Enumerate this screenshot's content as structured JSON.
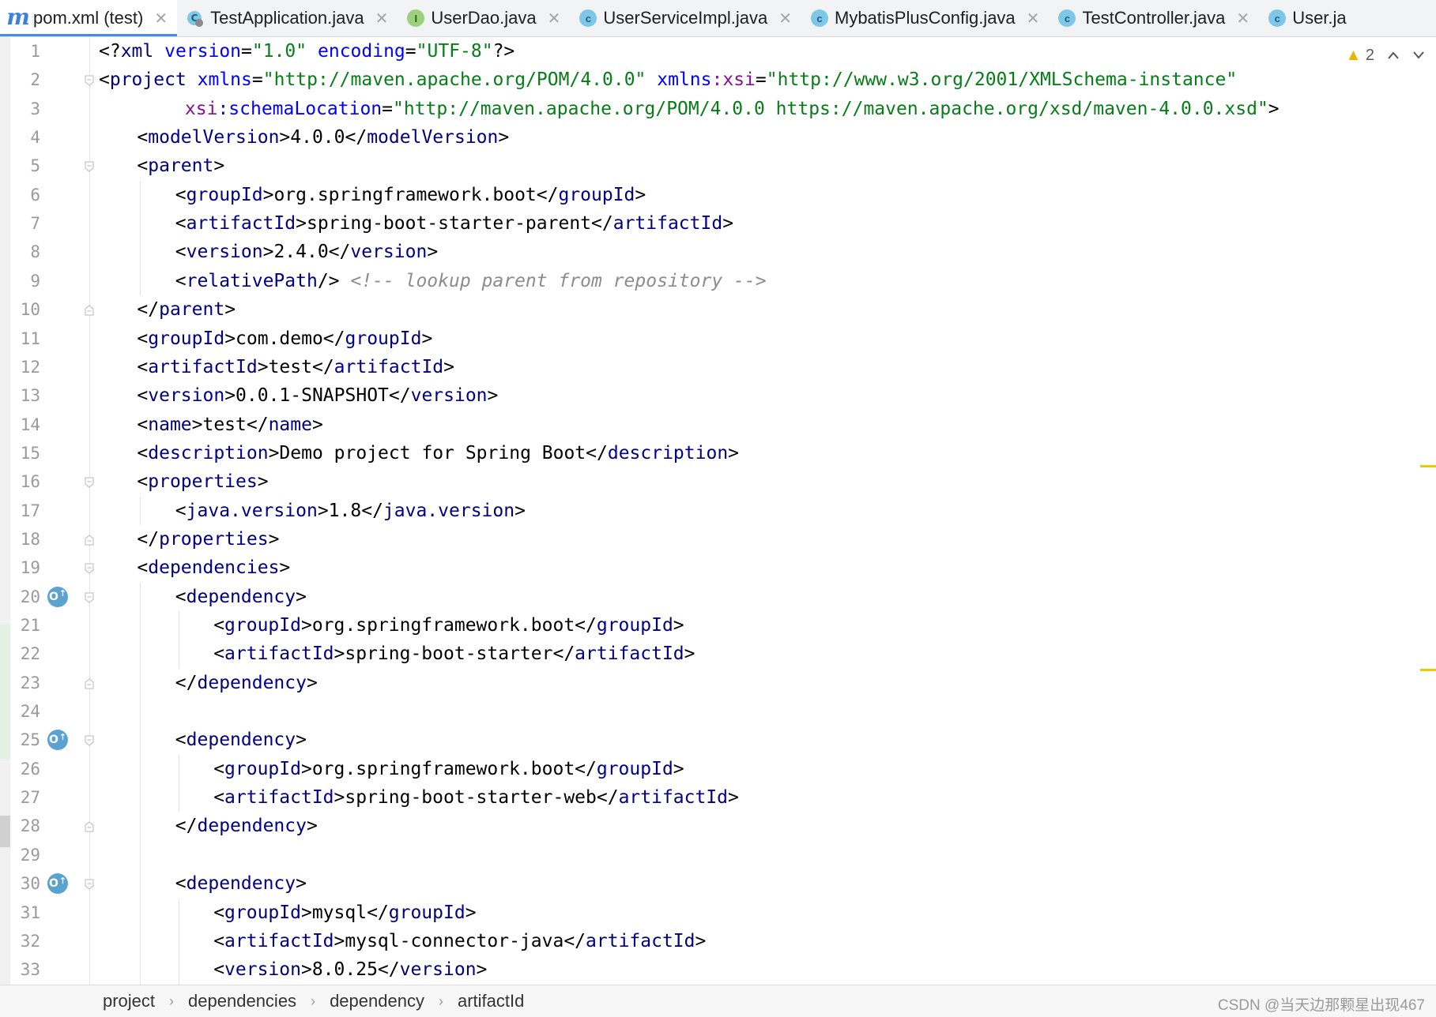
{
  "tabs": [
    {
      "label": "pom.xml (test)",
      "icon": "m-icon",
      "active": true
    },
    {
      "label": "TestApplication.java",
      "icon": "c-run-icon",
      "active": false
    },
    {
      "label": "UserDao.java",
      "icon": "i-icon",
      "active": false
    },
    {
      "label": "UserServiceImpl.java",
      "icon": "c-icon",
      "active": false
    },
    {
      "label": "MybatisPlusConfig.java",
      "icon": "c-icon",
      "active": false
    },
    {
      "label": "TestController.java",
      "icon": "c-icon",
      "active": false
    },
    {
      "label": "User.ja",
      "icon": "c-icon",
      "active": false
    }
  ],
  "inspection": {
    "warning_count": "2"
  },
  "lines": [
    {
      "n": "1",
      "indent": 0,
      "tokens": [
        [
          "b",
          "<?"
        ],
        [
          "t",
          "xml "
        ],
        [
          "a",
          "version"
        ],
        [
          "b",
          "="
        ],
        [
          "v",
          "\"1.0\""
        ],
        [
          "b",
          " "
        ],
        [
          "a",
          "encoding"
        ],
        [
          "b",
          "="
        ],
        [
          "v",
          "\"UTF-8\""
        ],
        [
          "b",
          "?>"
        ]
      ]
    },
    {
      "n": "2",
      "indent": 0,
      "fold": "open",
      "tokens": [
        [
          "b",
          "<"
        ],
        [
          "t",
          "project "
        ],
        [
          "a",
          "xmlns"
        ],
        [
          "b",
          "="
        ],
        [
          "v",
          "\"http://maven.apache.org/POM/4.0.0\""
        ],
        [
          "b",
          " "
        ],
        [
          "a",
          "xmlns"
        ],
        [
          "n",
          ":xsi"
        ],
        [
          "b",
          "="
        ],
        [
          "v",
          "\"http://www.w3.org/2001/XMLSchema-instance\""
        ]
      ]
    },
    {
      "n": "3",
      "indent": 9,
      "tokens": [
        [
          "n",
          "xsi"
        ],
        [
          "a",
          ":schemaLocation"
        ],
        [
          "b",
          "="
        ],
        [
          "v",
          "\"http://maven.apache.org/POM/4.0.0 https://maven.apache.org/xsd/maven-4.0.0.xsd\""
        ],
        [
          "b",
          ">"
        ]
      ]
    },
    {
      "n": "4",
      "indent": 4,
      "tokens": [
        [
          "b",
          "<"
        ],
        [
          "t",
          "modelVersion"
        ],
        [
          "b",
          ">4.0.0</"
        ],
        [
          "t",
          "modelVersion"
        ],
        [
          "b",
          ">"
        ]
      ]
    },
    {
      "n": "5",
      "indent": 4,
      "fold": "open",
      "tokens": [
        [
          "b",
          "<"
        ],
        [
          "t",
          "parent"
        ],
        [
          "b",
          ">"
        ]
      ]
    },
    {
      "n": "6",
      "indent": 8,
      "tokens": [
        [
          "b",
          "<"
        ],
        [
          "t",
          "groupId"
        ],
        [
          "b",
          ">org.springframework.boot</"
        ],
        [
          "t",
          "groupId"
        ],
        [
          "b",
          ">"
        ]
      ]
    },
    {
      "n": "7",
      "indent": 8,
      "tokens": [
        [
          "b",
          "<"
        ],
        [
          "t",
          "artifactId"
        ],
        [
          "b",
          ">spring-boot-starter-parent</"
        ],
        [
          "t",
          "artifactId"
        ],
        [
          "b",
          ">"
        ]
      ]
    },
    {
      "n": "8",
      "indent": 8,
      "tokens": [
        [
          "b",
          "<"
        ],
        [
          "t",
          "version"
        ],
        [
          "b",
          ">2.4.0</"
        ],
        [
          "t",
          "version"
        ],
        [
          "b",
          ">"
        ]
      ]
    },
    {
      "n": "9",
      "indent": 8,
      "tokens": [
        [
          "b",
          "<"
        ],
        [
          "t",
          "relativePath"
        ],
        [
          "b",
          "/> "
        ],
        [
          "c",
          "<!-- lookup parent from repository -->"
        ]
      ]
    },
    {
      "n": "10",
      "indent": 4,
      "fold": "close",
      "tokens": [
        [
          "b",
          "</"
        ],
        [
          "t",
          "parent"
        ],
        [
          "b",
          ">"
        ]
      ]
    },
    {
      "n": "11",
      "indent": 4,
      "tokens": [
        [
          "b",
          "<"
        ],
        [
          "t",
          "groupId"
        ],
        [
          "b",
          ">com.demo</"
        ],
        [
          "t",
          "groupId"
        ],
        [
          "b",
          ">"
        ]
      ]
    },
    {
      "n": "12",
      "indent": 4,
      "tokens": [
        [
          "b",
          "<"
        ],
        [
          "t",
          "artifactId"
        ],
        [
          "b",
          ">test</"
        ],
        [
          "t",
          "artifactId"
        ],
        [
          "b",
          ">"
        ]
      ]
    },
    {
      "n": "13",
      "indent": 4,
      "tokens": [
        [
          "b",
          "<"
        ],
        [
          "t",
          "version"
        ],
        [
          "b",
          ">0.0.1-SNAPSHOT</"
        ],
        [
          "t",
          "version"
        ],
        [
          "b",
          ">"
        ]
      ]
    },
    {
      "n": "14",
      "indent": 4,
      "tokens": [
        [
          "b",
          "<"
        ],
        [
          "t",
          "name"
        ],
        [
          "b",
          ">test</"
        ],
        [
          "t",
          "name"
        ],
        [
          "b",
          ">"
        ]
      ]
    },
    {
      "n": "15",
      "indent": 4,
      "tokens": [
        [
          "b",
          "<"
        ],
        [
          "t",
          "description"
        ],
        [
          "b",
          ">Demo project for Spring Boot</"
        ],
        [
          "t",
          "description"
        ],
        [
          "b",
          ">"
        ]
      ]
    },
    {
      "n": "16",
      "indent": 4,
      "fold": "open",
      "tokens": [
        [
          "b",
          "<"
        ],
        [
          "t",
          "properties"
        ],
        [
          "b",
          ">"
        ]
      ]
    },
    {
      "n": "17",
      "indent": 8,
      "tokens": [
        [
          "b",
          "<"
        ],
        [
          "t",
          "java.version"
        ],
        [
          "b",
          ">1.8</"
        ],
        [
          "t",
          "java.version"
        ],
        [
          "b",
          ">"
        ]
      ]
    },
    {
      "n": "18",
      "indent": 4,
      "fold": "close",
      "tokens": [
        [
          "b",
          "</"
        ],
        [
          "t",
          "properties"
        ],
        [
          "b",
          ">"
        ]
      ]
    },
    {
      "n": "19",
      "indent": 4,
      "fold": "open",
      "tokens": [
        [
          "b",
          "<"
        ],
        [
          "t",
          "dependencies"
        ],
        [
          "b",
          ">"
        ]
      ]
    },
    {
      "n": "20",
      "indent": 8,
      "fold": "open",
      "dep": true,
      "tokens": [
        [
          "b",
          "<"
        ],
        [
          "t",
          "dependency"
        ],
        [
          "b",
          ">"
        ]
      ]
    },
    {
      "n": "21",
      "indent": 12,
      "tokens": [
        [
          "b",
          "<"
        ],
        [
          "t",
          "groupId"
        ],
        [
          "b",
          ">org.springframework.boot</"
        ],
        [
          "t",
          "groupId"
        ],
        [
          "b",
          ">"
        ]
      ]
    },
    {
      "n": "22",
      "indent": 12,
      "tokens": [
        [
          "b",
          "<"
        ],
        [
          "t",
          "artifactId"
        ],
        [
          "b",
          ">spring-boot-starter</"
        ],
        [
          "t",
          "artifactId"
        ],
        [
          "b",
          ">"
        ]
      ]
    },
    {
      "n": "23",
      "indent": 8,
      "fold": "close",
      "tokens": [
        [
          "b",
          "</"
        ],
        [
          "t",
          "dependency"
        ],
        [
          "b",
          ">"
        ]
      ]
    },
    {
      "n": "24",
      "indent": 0,
      "tokens": []
    },
    {
      "n": "25",
      "indent": 8,
      "fold": "open",
      "dep": true,
      "tokens": [
        [
          "b",
          "<"
        ],
        [
          "t",
          "dependency"
        ],
        [
          "b",
          ">"
        ]
      ]
    },
    {
      "n": "26",
      "indent": 12,
      "tokens": [
        [
          "b",
          "<"
        ],
        [
          "t",
          "groupId"
        ],
        [
          "b",
          ">org.springframework.boot</"
        ],
        [
          "t",
          "groupId"
        ],
        [
          "b",
          ">"
        ]
      ]
    },
    {
      "n": "27",
      "indent": 12,
      "tokens": [
        [
          "b",
          "<"
        ],
        [
          "t",
          "artifactId"
        ],
        [
          "b",
          ">spring-boot-starter-web</"
        ],
        [
          "t",
          "artifactId"
        ],
        [
          "b",
          ">"
        ]
      ]
    },
    {
      "n": "28",
      "indent": 8,
      "fold": "close",
      "tokens": [
        [
          "b",
          "</"
        ],
        [
          "t",
          "dependency"
        ],
        [
          "b",
          ">"
        ]
      ]
    },
    {
      "n": "29",
      "indent": 0,
      "tokens": []
    },
    {
      "n": "30",
      "indent": 8,
      "fold": "open",
      "dep": true,
      "tokens": [
        [
          "b",
          "<"
        ],
        [
          "t",
          "dependency"
        ],
        [
          "b",
          ">"
        ]
      ]
    },
    {
      "n": "31",
      "indent": 12,
      "tokens": [
        [
          "b",
          "<"
        ],
        [
          "t",
          "groupId"
        ],
        [
          "b",
          ">mysql</"
        ],
        [
          "t",
          "groupId"
        ],
        [
          "b",
          ">"
        ]
      ]
    },
    {
      "n": "32",
      "indent": 12,
      "tokens": [
        [
          "b",
          "<"
        ],
        [
          "t",
          "artifactId"
        ],
        [
          "b",
          ">mysql-connector-java</"
        ],
        [
          "t",
          "artifactId"
        ],
        [
          "b",
          ">"
        ]
      ]
    },
    {
      "n": "33",
      "indent": 12,
      "tokens": [
        [
          "b",
          "<"
        ],
        [
          "t",
          "version"
        ],
        [
          "b",
          ">8.0.25</"
        ],
        [
          "t",
          "version"
        ],
        [
          "b",
          ">"
        ]
      ]
    }
  ],
  "breadcrumb": [
    "project",
    "dependencies",
    "dependency",
    "artifactId"
  ],
  "watermark": "CSDN @当天边那颗星出现467",
  "colors": {
    "tag": "#000080",
    "attribute": "#0000ff",
    "namespace": "#871094",
    "value": "#067d17",
    "comment": "#8c8c8c",
    "active_tab_underline": "#4a8cd9"
  }
}
